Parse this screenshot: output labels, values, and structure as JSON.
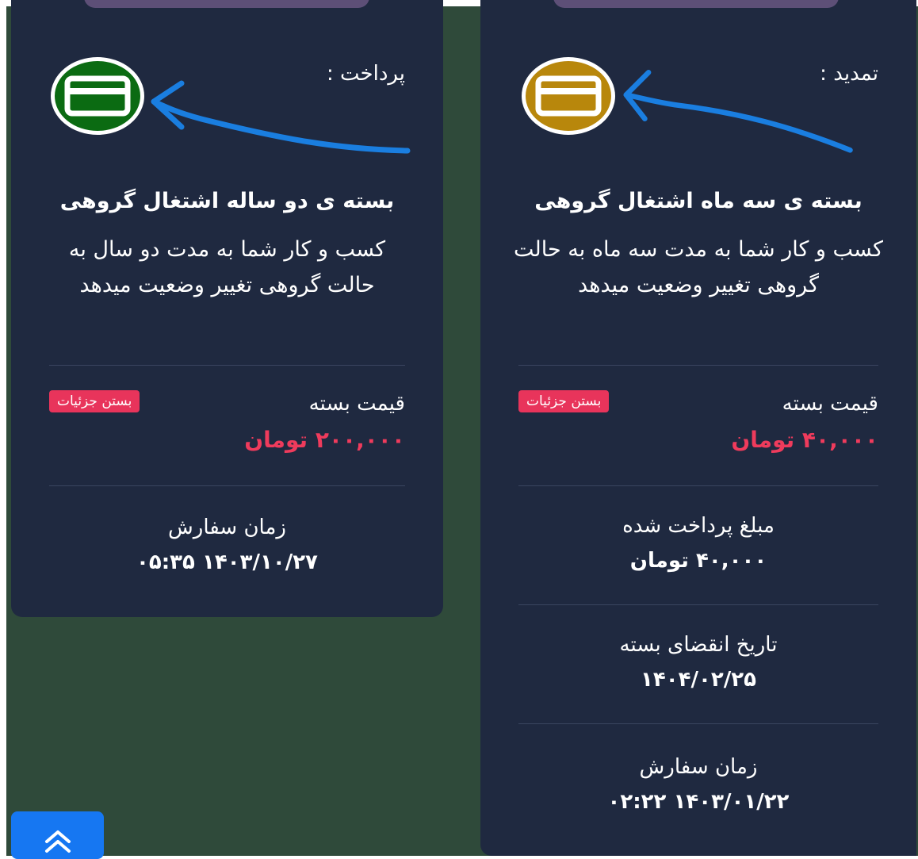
{
  "colors": {
    "page_bg": "#2f4a3a",
    "card_bg": "#1f2940",
    "price_red": "#ef3b5c",
    "badge_red": "#e8345b",
    "pay_green": "#0b6b12",
    "renew_gold": "#b8870c",
    "arrow_blue": "#1a7ee0",
    "scroll_btn_blue": "#1677f2"
  },
  "cards": [
    {
      "action_label": "پرداخت :",
      "action_icon": "credit-card-icon",
      "title": "بسته ی دو ساله اشتغال گروهی",
      "description": "کسب و کار شما به مدت دو سال به حالت گروهی تغییر وضعیت میدهد",
      "price_label": "قیمت بسته",
      "price_value": "۲۰۰,۰۰۰ تومان",
      "details_button": "بستن جزئیات",
      "order_time_label": "زمان سفارش",
      "order_time_value": "۱۴۰۳/۱۰/۲۷ ۰۵:۳۵"
    },
    {
      "action_label": "تمدید :",
      "action_icon": "credit-card-icon",
      "title": "بسته ی سه ماه اشتغال گروهی",
      "description": "کسب و کار شما به مدت سه ماه به حالت گروهی تغییر وضعیت میدهد",
      "price_label": "قیمت بسته",
      "price_value": "۴۰,۰۰۰ تومان",
      "details_button": "بستن جزئیات",
      "paid_amount_label": "مبلغ پرداخت شده",
      "paid_amount_value": "۴۰,۰۰۰ تومان",
      "expiry_label": "تاریخ انقضای بسته",
      "expiry_value": "۱۴۰۴/۰۲/۲۵",
      "order_time_label": "زمان سفارش",
      "order_time_value": "۱۴۰۳/۰۱/۲۲ ۰۲:۲۲"
    }
  ],
  "scroll_top_icon": "double-chevron-up-icon"
}
